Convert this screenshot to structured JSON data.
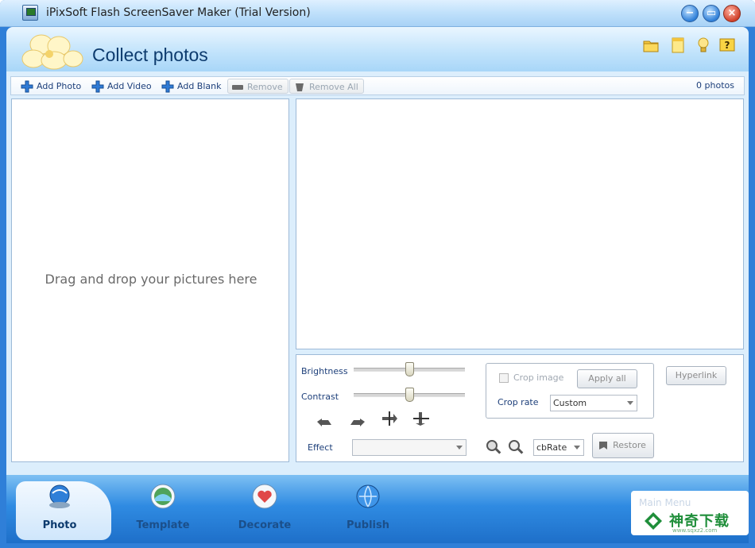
{
  "window": {
    "title": "iPixSoft Flash ScreenSaver Maker (Trial Version)",
    "minimize_icon": "minimize-icon",
    "maximize_icon": "maximize-icon",
    "close_icon": "close-icon"
  },
  "header": {
    "title": "Collect photos",
    "icons": [
      "folder-icon",
      "note-icon",
      "bulb-icon",
      "help-icon"
    ]
  },
  "toolbar": {
    "add_photo": "Add Photo",
    "add_video": "Add Video",
    "add_blank": "Add Blank",
    "remove": "Remove",
    "remove_all": "Remove All",
    "photo_count": "0 photos"
  },
  "drop_area": {
    "hint": "Drag and drop your pictures here"
  },
  "editor": {
    "brightness_label": "Brightness",
    "contrast_label": "Contrast",
    "brightness_value": 0.5,
    "contrast_value": 0.5,
    "transform_icons": [
      "rotate-left-icon",
      "rotate-right-icon",
      "flip-horizontal-icon",
      "flip-vertical-icon"
    ],
    "effect_label": "Effect",
    "effect_value": "",
    "crop_label": "Crop image",
    "apply_all": "Apply all",
    "crop_rate_label": "Crop rate",
    "crop_rate_value": "Custom",
    "hyperlink": "Hyperlink",
    "zoom_icons": [
      "zoom-in-icon",
      "zoom-out-icon"
    ],
    "cb_rate_value": "cbRate",
    "restore": "Restore"
  },
  "tabs": [
    {
      "label": "Photo",
      "active": true
    },
    {
      "label": "Template",
      "active": false
    },
    {
      "label": "Decorate",
      "active": false
    },
    {
      "label": "Publish",
      "active": false
    }
  ],
  "promo": {
    "menu_text": "Main Menu",
    "brand": "神奇下载",
    "url": "www.sqxz2.com"
  }
}
